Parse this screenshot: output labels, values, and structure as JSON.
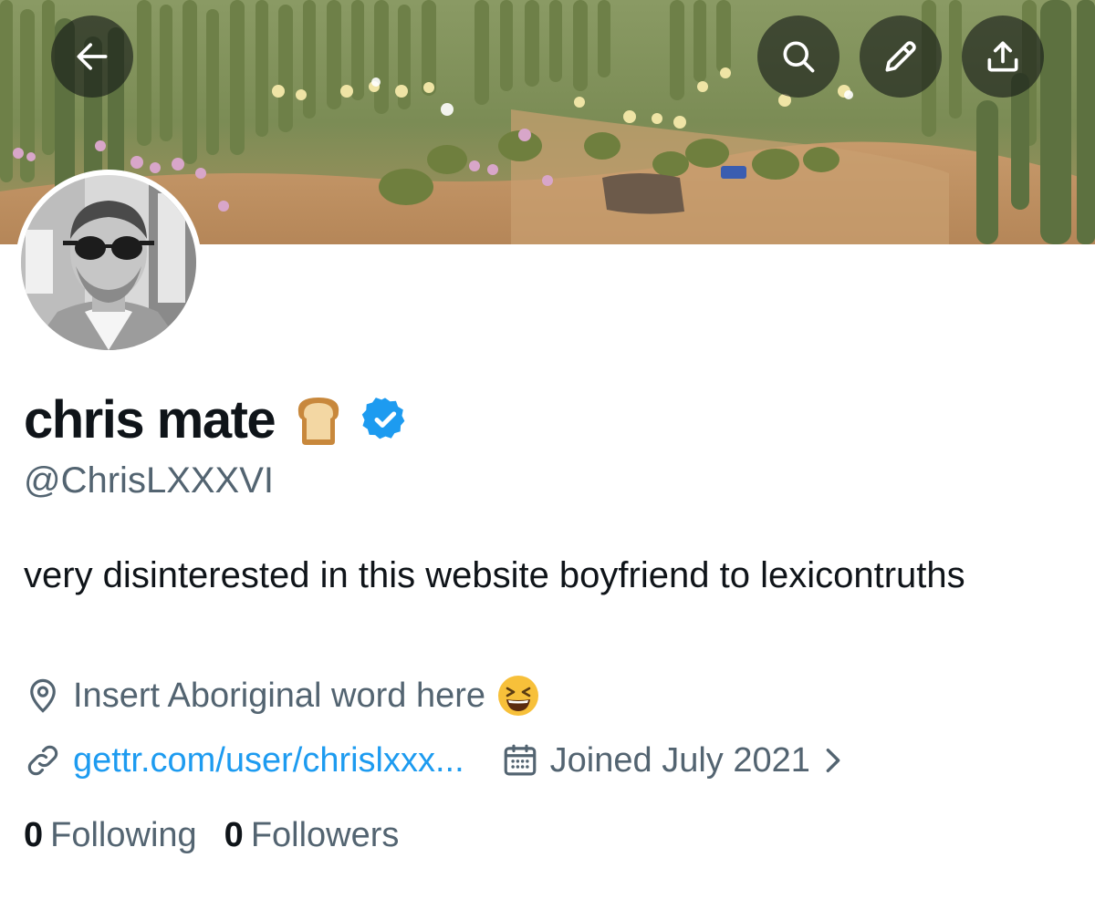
{
  "profile": {
    "display_name": "chris mate",
    "handle": "@ChrisLXXXVI",
    "bio": "very disinterested in this website boyfriend to lexicontruths",
    "location": "Insert Aboriginal word here",
    "website": "gettr.com/user/chrislxxx...",
    "joined": "Joined July 2021",
    "verified": true,
    "name_emoji": "bread-icon",
    "location_emoji": "grinning-squinting-face-icon"
  },
  "stats": {
    "following_count": "0",
    "following_label": "Following",
    "followers_count": "0",
    "followers_label": "Followers"
  },
  "header_buttons": [
    "back-arrow-icon",
    "search-icon",
    "edit-pencil-icon",
    "share-upload-icon"
  ],
  "colors": {
    "link": "#1d9bf0",
    "secondary_text": "#536471",
    "primary_text": "#0f1419",
    "verified_badge": "#1d9bf0"
  }
}
